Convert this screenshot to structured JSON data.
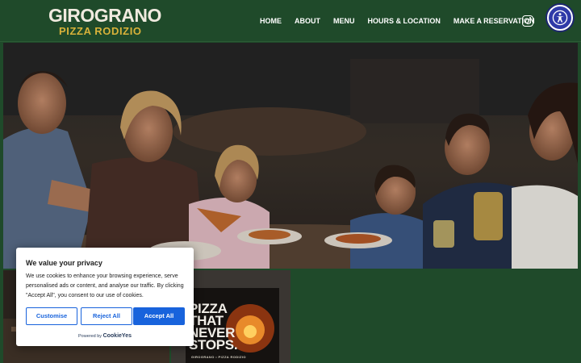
{
  "brand": {
    "name_line1": "GIROGRANO",
    "name_line2": "PIZZA RODIZIO",
    "bg_color": "#1f4a2a",
    "gold_color": "#d8b23a"
  },
  "nav": {
    "items": [
      {
        "label": "HOME"
      },
      {
        "label": "ABOUT"
      },
      {
        "label": "MENU"
      },
      {
        "label": "HOURS & LOCATION"
      },
      {
        "label": "MAKE A RESERVATION"
      }
    ],
    "social_icon": "instagram-icon",
    "accessibility_icon": "accessibility-icon"
  },
  "hero": {
    "image": "family sharing pizza at a restaurant table"
  },
  "poster": {
    "headline": "PIZZA\nTHAT\nNEVER\nSTOPS.",
    "footer": "GIROGRANO • PIZZA RODIZIO"
  },
  "cookie_banner": {
    "title": "We value your privacy",
    "body": "We use cookies to enhance your browsing experience, serve personalised ads or content, and analyse our traffic. By clicking \"Accept All\", you consent to our use of cookies.",
    "buttons": {
      "customise": "Customise",
      "reject": "Reject All",
      "accept": "Accept All"
    },
    "powered_by": "Powered by",
    "powered_brand": "CookieYes",
    "accent_color": "#1863dc"
  }
}
